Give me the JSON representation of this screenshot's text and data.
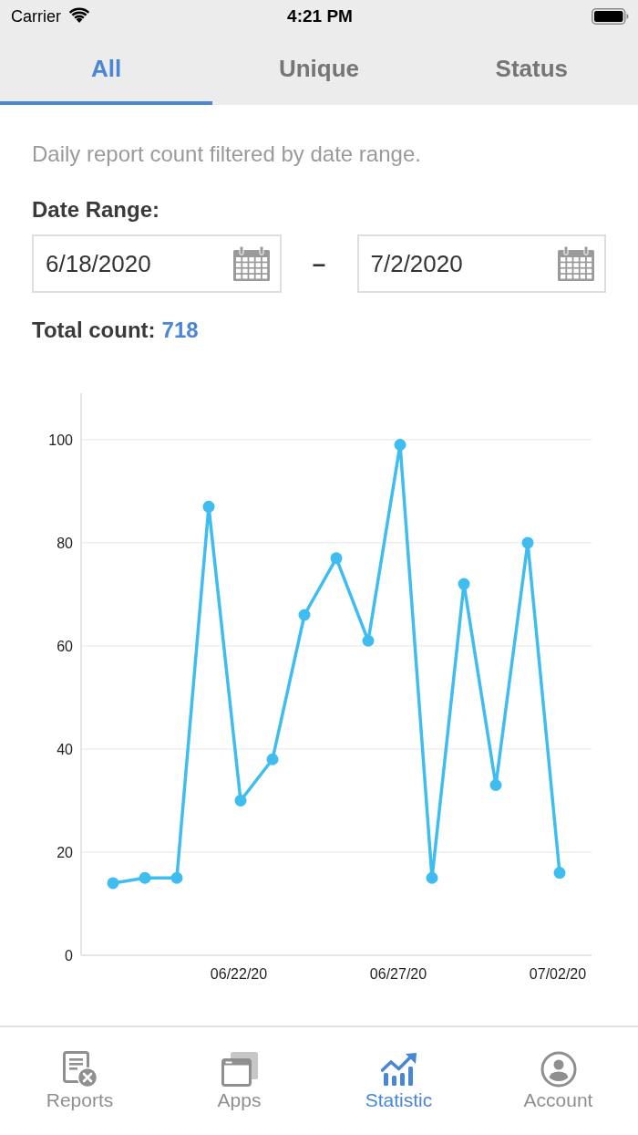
{
  "status_bar": {
    "carrier": "Carrier",
    "time": "4:21 PM"
  },
  "tabs": [
    {
      "label": "All",
      "selected": true
    },
    {
      "label": "Unique",
      "selected": false
    },
    {
      "label": "Status",
      "selected": false
    }
  ],
  "description": "Daily report count filtered by date range.",
  "date_range": {
    "label": "Date Range:",
    "start": "6/18/2020",
    "separator": "–",
    "end": "7/2/2020"
  },
  "total": {
    "label": "Total count:",
    "value": "718"
  },
  "chart": {
    "chart_data": {
      "type": "line",
      "categories": [
        null,
        null,
        null,
        null,
        "06/22/20",
        null,
        null,
        null,
        null,
        "06/27/20",
        null,
        null,
        null,
        null,
        "07/02/20"
      ],
      "series": [
        {
          "color": "#3fbdf1",
          "marker": true,
          "values": [
            14,
            15,
            15,
            87,
            30,
            38,
            66,
            77,
            61,
            99,
            15,
            72,
            33,
            80,
            16
          ]
        }
      ],
      "ylim": [
        0,
        109
      ],
      "yticks": [
        0,
        20,
        40,
        60,
        80,
        100
      ],
      "grid": true
    }
  },
  "tab_bar": [
    {
      "label": "Reports",
      "selected": false
    },
    {
      "label": "Apps",
      "selected": false
    },
    {
      "label": "Statistic",
      "selected": true
    },
    {
      "label": "Account",
      "selected": false
    }
  ]
}
